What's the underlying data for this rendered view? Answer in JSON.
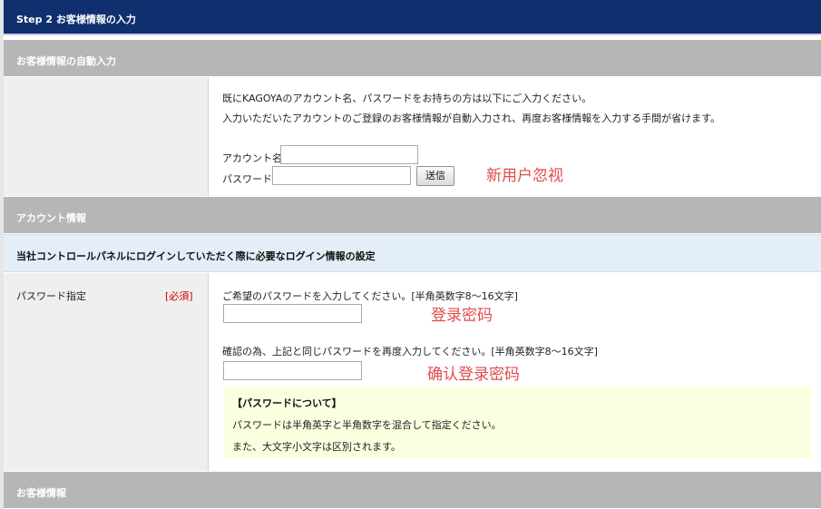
{
  "step_header": {
    "title": "Step 2 お客様情報の入力"
  },
  "auto_section": {
    "bar_title": "お客様情報の自動入力",
    "intro_line1": "既にKAGOYAのアカウント名、パスワードをお持ちの方は以下にご入力ください。",
    "intro_line2": "入力いただいたアカウントのご登録のお客様情報が自動入力され、再度お客様情報を入力する手間が省けます。",
    "account_label": "アカウント名",
    "account_value": "",
    "password_label": "パスワード",
    "password_value": "",
    "submit_label": "送信",
    "annotation": "新用户忽视"
  },
  "account_section": {
    "bar_title": "アカウント情報",
    "notice": "当社コントロールパネルにログインしていただく際に必要なログイン情報の設定",
    "password_row": {
      "label": "パスワード指定",
      "required_badge": "[必須]",
      "instruction1": "ご希望のパスワードを入力してください。[半角英数字8～16文字]",
      "password_value": "",
      "annotation1": "登录密码",
      "instruction2": "確認の為、上記と同じパスワードを再度入力してください。[半角英数字8～16文字]",
      "confirm_value": "",
      "annotation2": "确认登录密码",
      "note_title": "【パスワードについて】",
      "note_line1": "パスワードは半角英字と半角数字を混合して指定ください。",
      "note_line2": "また、大文字小文字は区別されます。"
    }
  },
  "customer_section": {
    "bar_title": "お客様情報"
  },
  "colors": {
    "header_bg": "#0f2f6f",
    "section_bar_bg": "#b6b6b6",
    "notice_bg": "#e3eef8",
    "note_bg": "#fbffe0",
    "annotation": "#e14b4b",
    "required": "#cc0000"
  }
}
